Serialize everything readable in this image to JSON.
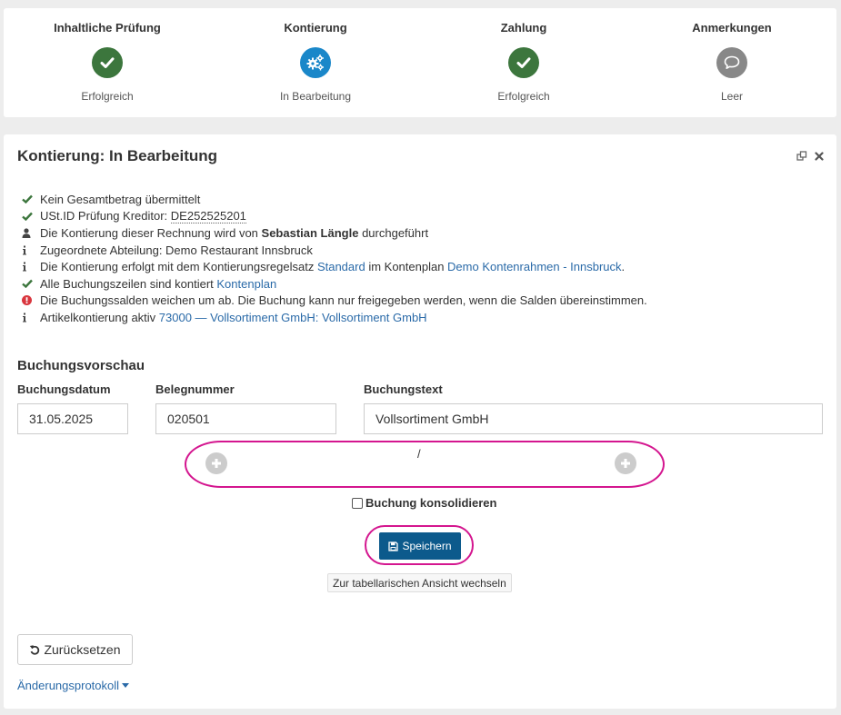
{
  "colors": {
    "success": "#3c763d",
    "in_progress": "#1a87c9",
    "empty": "#888888",
    "link": "#2a6aa8",
    "primary_button": "#0c5a8c",
    "highlight": "#d4168f",
    "error": "#d9363e"
  },
  "steps": [
    {
      "title": "Inhaltliche Prüfung",
      "status": "Erfolgreich",
      "icon": "check-icon"
    },
    {
      "title": "Kontierung",
      "status": "In Bearbeitung",
      "icon": "cogs-icon"
    },
    {
      "title": "Zahlung",
      "status": "Erfolgreich",
      "icon": "check-icon"
    },
    {
      "title": "Anmerkungen",
      "status": "Leer",
      "icon": "comment-icon"
    }
  ],
  "card": {
    "title": "Kontierung: In Bearbeitung"
  },
  "info": {
    "line1": "Kein Gesamtbetrag übermittelt",
    "line2_prefix": "USt.ID Prüfung Kreditor: ",
    "line2_value": "DE252525201",
    "line3_prefix": "Die Kontierung dieser Rechnung wird von ",
    "line3_name": "Sebastian Längle",
    "line3_suffix": " durchgeführt",
    "line4": "Zugeordnete Abteilung: Demo Restaurant Innsbruck",
    "line5_prefix": "Die Kontierung erfolgt mit dem Kontierungsregelsatz ",
    "line5_link1": "Standard",
    "line5_mid": " im Kontenplan ",
    "line5_link2": "Demo Kontenrahmen - Innsbruck",
    "line5_suffix": ".",
    "line6_prefix": "Alle Buchungszeilen sind kontiert ",
    "line6_link": "Kontenplan",
    "line7": "Die Buchungssalden weichen um ab. Die Buchung kann nur freigegeben werden, wenn die Salden übereinstimmen.",
    "line8_prefix": "Artikelkontierung aktiv ",
    "line8_link": "73000 — Vollsortiment GmbH: Vollsortiment GmbH"
  },
  "booking": {
    "section_title": "Buchungsvorschau",
    "date_label": "Buchungsdatum",
    "date_value": "31.05.2025",
    "number_label": "Belegnummer",
    "number_value": "020501",
    "text_label": "Buchungstext",
    "text_value": "Vollsortiment GmbH",
    "separator": "/",
    "consolidate_label": "Buchung konsolidieren",
    "save_label": "Speichern",
    "switch_view_label": "Zur tabellarischen Ansicht wechseln"
  },
  "footer": {
    "reset_label": "Zurücksetzen",
    "protocol_label": "Änderungsprotokoll"
  }
}
